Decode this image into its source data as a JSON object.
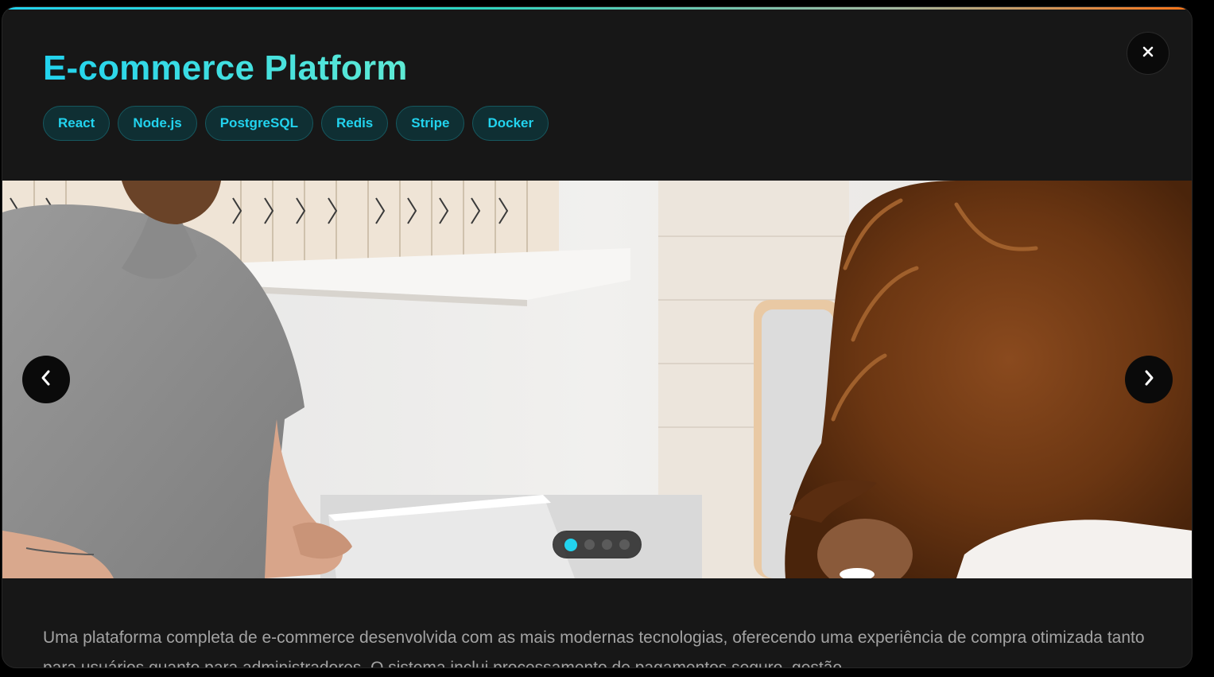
{
  "project": {
    "title": "E-commerce Platform",
    "tags": [
      "React",
      "Node.js",
      "PostgreSQL",
      "Redis",
      "Stripe",
      "Docker"
    ],
    "description": "Uma plataforma completa de e-commerce desenvolvida com as mais modernas tecnologias, oferecendo uma experiência de compra otimizada tanto para usuários quanto para administradores. O sistema inclui processamento de pagamentos seguro, gestão"
  },
  "carousel": {
    "slide_count": 4,
    "active_index": 0
  },
  "colors": {
    "accent": "#22d3ee",
    "accent_secondary": "#5eead4",
    "modal_bg": "#171717",
    "tag_bg": "#0f2f33",
    "description_text": "#a3a3a3"
  },
  "icons": {
    "close": "close-icon",
    "prev": "chevron-left-icon",
    "next": "chevron-right-icon"
  }
}
